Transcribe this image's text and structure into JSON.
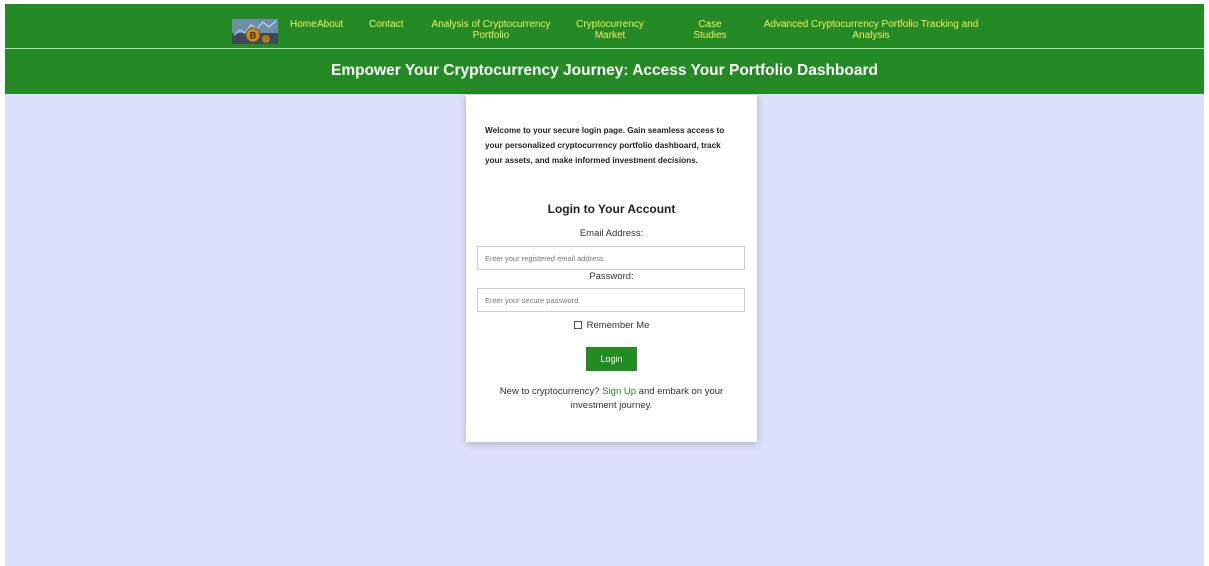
{
  "colors": {
    "header_bg": "#248a25",
    "nav_link": "#f4f05a",
    "page_bg": "#dde0fa",
    "button_bg": "#228b22",
    "link": "#228b22"
  },
  "nav": {
    "logo_icon": "bitcoin-logo-icon",
    "links": [
      {
        "label": "Home"
      },
      {
        "label": "About"
      },
      {
        "label": "Contact"
      },
      {
        "label": "Analysis of Cryptocurrency",
        "label2": "Portfolio"
      },
      {
        "label": "Cryptocurrency",
        "label2": "Market"
      },
      {
        "label": "Case",
        "label2": "Studies"
      },
      {
        "label": "Advanced Cryptocurrency Portfolio Tracking and",
        "label2": "Analysis"
      }
    ]
  },
  "banner": {
    "title": "Empower Your Cryptocurrency Journey: Access Your Portfolio Dashboard"
  },
  "login": {
    "welcome": "Welcome to your secure login page. Gain seamless access to your personalized cryptocurrency portfolio dashboard, track your assets, and make informed investment decisions.",
    "title": "Login to Your Account",
    "email_label": "Email Address:",
    "email_placeholder": "Enter your registered email address",
    "email_value": "",
    "password_label": "Password:",
    "password_placeholder": "Enter your secure password",
    "password_value": "",
    "remember_label": "Remember Me",
    "remember_checked": false,
    "button_label": "Login",
    "signup_prefix": "New to cryptocurrency? ",
    "signup_link": "Sign Up",
    "signup_suffix": " and embark on your investment journey."
  }
}
